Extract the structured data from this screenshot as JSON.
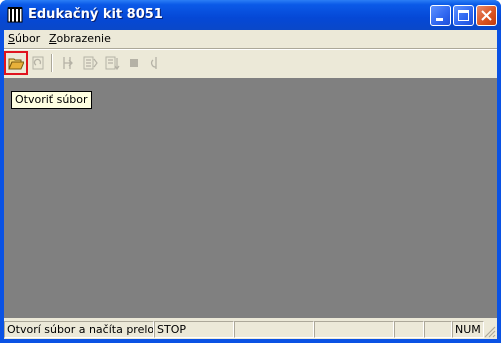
{
  "window": {
    "title": "Edukačný kit 8051",
    "controls": [
      "minimize",
      "maximize",
      "close"
    ]
  },
  "menu": {
    "items": [
      {
        "label": "Súbor",
        "accel": "S",
        "rest": "úbor"
      },
      {
        "label": "Zobrazenie",
        "accel": "Z",
        "rest": "obrazenie"
      }
    ]
  },
  "toolbar": {
    "buttons": [
      {
        "name": "open-file",
        "icon": "folder-open-icon",
        "enabled": true,
        "highlighted": true
      },
      {
        "name": "reload",
        "icon": "reload-icon",
        "enabled": false
      },
      {
        "name": "step-into",
        "icon": "step-into-icon",
        "enabled": false
      },
      {
        "name": "step-over",
        "icon": "step-over-icon",
        "enabled": false
      },
      {
        "name": "run-to",
        "icon": "run-to-icon",
        "enabled": false
      },
      {
        "name": "stop",
        "icon": "stop-icon",
        "enabled": false
      },
      {
        "name": "reset",
        "icon": "reset-icon",
        "enabled": false
      }
    ],
    "highlight_color": "#e0141e"
  },
  "tooltip": {
    "text": "Otvoriť súbor"
  },
  "status": {
    "message": "Otvorí súbor a načíta preložen",
    "state": "STOP",
    "numlock": "NUM"
  },
  "colors": {
    "titlebar": "#0548d6",
    "workspace": "#808080",
    "chrome": "#ece9d8",
    "close_button": "#d9521f"
  }
}
